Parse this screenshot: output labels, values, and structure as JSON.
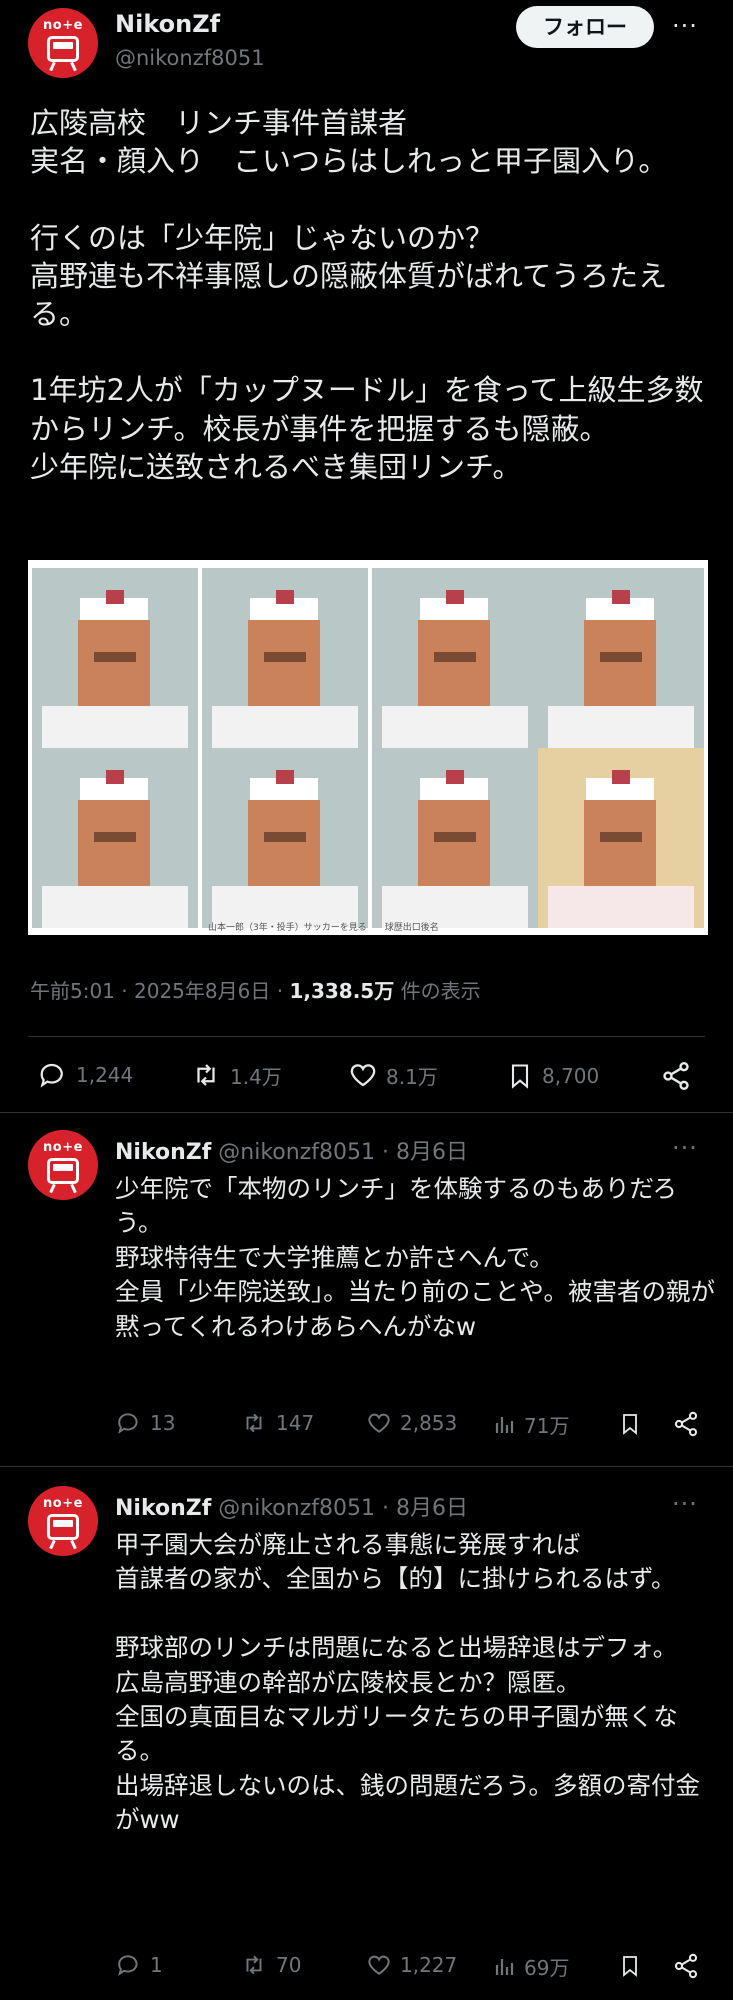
{
  "main_post": {
    "user_name": "NikonZf",
    "handle": "@nikonzf8051",
    "follow_label": "フォロー",
    "more": "···",
    "text": "広陵高校　リンチ事件首謀者\n実名・顔入り　こいつらはしれっと甲子園入り。\n\n行くのは「少年院」じゃないのか？\n高野連も不祥事隠しの隠蔽体質がばれてうろたえる。\n\n1年坊2人が「カップヌードル」を食って上級生多数からリンチ。校長が事件を把握するも隠蔽。\n少年院に送致されるべき集団リンチ。",
    "image_caption": "山本一郎（3年・投手）サッカーを見る　　球歴出口後名",
    "time": "午前5:01",
    "date": "2025年8月6日",
    "views": "1,338.5万",
    "views_label": "件の表示",
    "replies": "1,244",
    "reposts": "1.4万",
    "likes": "8.1万",
    "bookmarks": "8,700"
  },
  "replies": [
    {
      "user_name": "NikonZf",
      "handle": "@nikonzf8051",
      "date": "· 8月6日",
      "text": "少年院で「本物のリンチ」を体験するのもありだろう。\n野球特待生で大学推薦とか許さへんで。\n全員「少年院送致」。当たり前のことや。被害者の親が\n黙ってくれるわけあらへんがなw",
      "replies": "13",
      "reposts": "147",
      "likes": "2,853",
      "views": "71万"
    },
    {
      "user_name": "NikonZf",
      "handle": "@nikonzf8051",
      "date": "· 8月6日",
      "text": "甲子園大会が廃止される事態に発展すれば\n首謀者の家が、全国から【的】に掛けられるはず。\n\n野球部のリンチは問題になると出場辞退はデフォ。\n広島高野連の幹部が広陵校長とか？隠匿。\n全国の真面目なマルガリータたちの甲子園が無くなる。\n出場辞退しないのは、銭の問題だろう。多額の寄付金がww",
      "replies": "1",
      "reposts": "70",
      "likes": "1,227",
      "views": "69万"
    }
  ],
  "avatar_text": "no+e",
  "colors": {
    "background": "#000000",
    "text": "#e7e9ea",
    "muted": "#71767b",
    "avatar": "#d8222b",
    "divider": "#2f3336"
  }
}
